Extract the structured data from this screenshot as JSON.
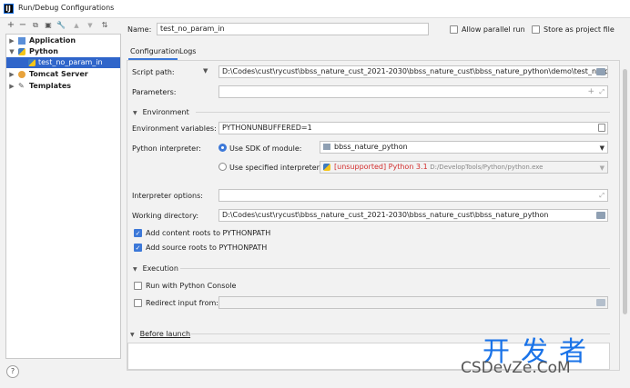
{
  "window": {
    "title": "Run/Debug Configurations",
    "logo_text": "IJ"
  },
  "toolbar": {
    "add": "+",
    "remove": "−",
    "copy": "⧉",
    "save": "▣",
    "wrench": "🔧",
    "up": "▲",
    "down": "▼",
    "sort": "⇅"
  },
  "tree": {
    "items": [
      {
        "label": "Application"
      },
      {
        "label": "Python"
      },
      {
        "label": "test_no_param_in"
      },
      {
        "label": "Tomcat Server"
      },
      {
        "label": "Templates"
      }
    ]
  },
  "header": {
    "name_label": "Name:",
    "name_value": "test_no_param_in",
    "allow_parallel_label": "Allow parallel run",
    "store_project_label": "Store as project file"
  },
  "tabs": [
    {
      "label": "Configuration"
    },
    {
      "label": "Logs"
    }
  ],
  "form": {
    "script_path_label": "Script path:",
    "script_path_value": "D:\\Codes\\cust\\rycust\\bbss_nature_cust_2021-2030\\bbss_nature_cust\\bbss_nature_python\\demo\\test_no_param_in",
    "parameters_label": "Parameters:",
    "parameters_value": "",
    "environment_section": "Environment",
    "env_vars_label": "Environment variables:",
    "env_vars_value": "PYTHONUNBUFFERED=1",
    "interpreter_label": "Python interpreter:",
    "use_sdk_label": "Use SDK of module:",
    "sdk_module_value": "bbss_nature_python",
    "use_specified_label": "Use specified interpreter:",
    "specified_unsupported": "[unsupported]",
    "specified_version": "Python 3.1",
    "specified_path": "D:/DevelopTools/Python/python.exe",
    "interp_options_label": "Interpreter options:",
    "interp_options_value": "",
    "working_dir_label": "Working directory:",
    "working_dir_value": "D:\\Codes\\cust\\rycust\\bbss_nature_cust_2021-2030\\bbss_nature_cust\\bbss_nature_python",
    "add_content_roots_label": "Add content roots to PYTHONPATH",
    "add_source_roots_label": "Add source roots to PYTHONPATH",
    "execution_section": "Execution",
    "run_console_label": "Run with Python Console",
    "redirect_label": "Redirect input from:",
    "redirect_value": "",
    "before_launch_section": "Before launch"
  },
  "footer": {
    "help": "?"
  },
  "watermark": {
    "top": "开发者",
    "bottom": "CSDevZe.CoM"
  },
  "colors": {
    "accent": "#3c78d8",
    "selection": "#2f65ca",
    "error": "#d32f2f"
  }
}
